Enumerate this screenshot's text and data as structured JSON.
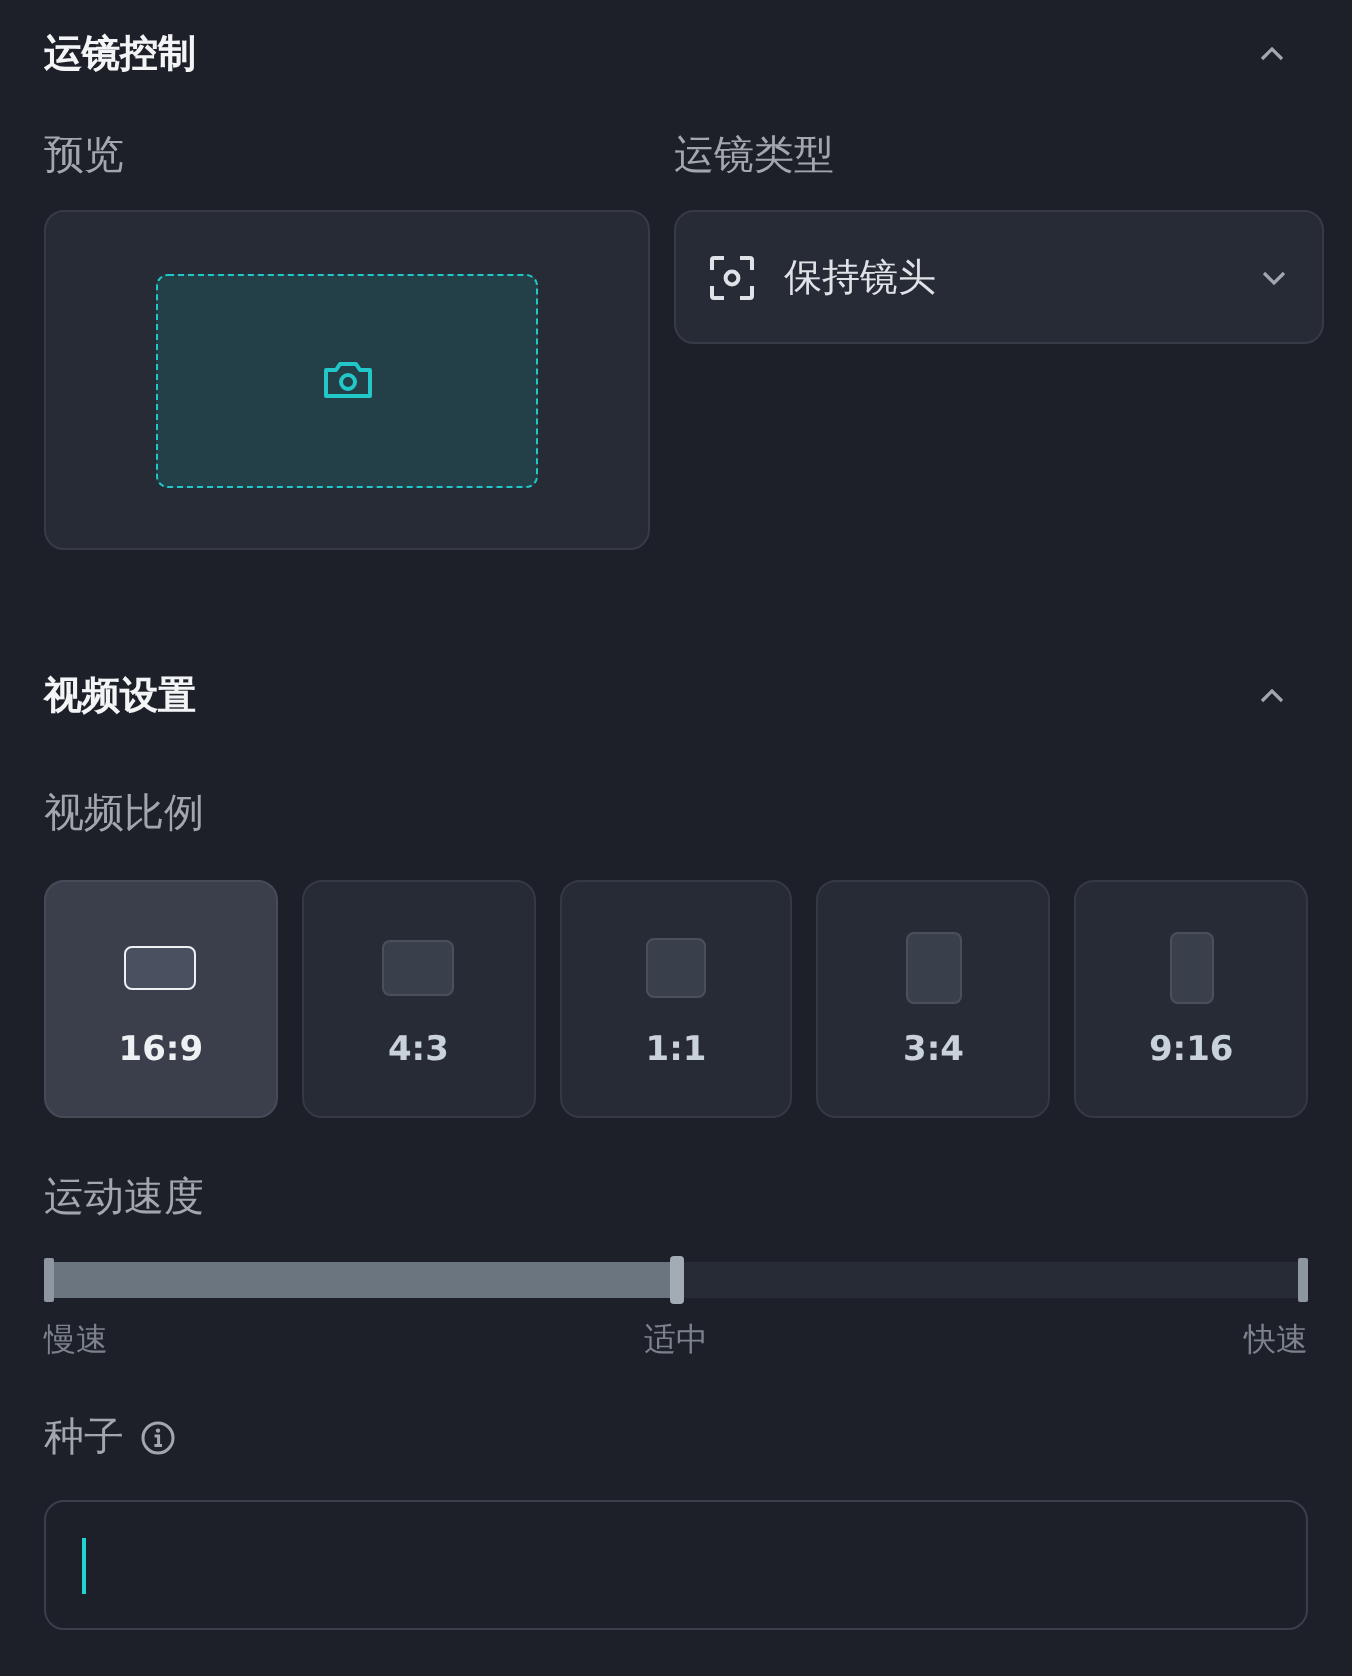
{
  "camera_section": {
    "title": "运镜控制",
    "expanded": true,
    "preview": {
      "label": "预览"
    },
    "motion_type": {
      "label": "运镜类型",
      "value": "保持镜头"
    }
  },
  "video_section": {
    "title": "视频设置",
    "expanded": true,
    "aspect_ratio": {
      "label": "视频比例",
      "options": [
        {
          "label": "16:9",
          "kind": "wide",
          "selected": true
        },
        {
          "label": "4:3",
          "kind": "standard",
          "selected": false
        },
        {
          "label": "1:1",
          "kind": "square",
          "selected": false
        },
        {
          "label": "3:4",
          "kind": "portrait",
          "selected": false
        },
        {
          "label": "9:16",
          "kind": "tall",
          "selected": false
        }
      ]
    },
    "motion_speed": {
      "label": "运动速度",
      "level": 0.5,
      "marks": [
        "慢速",
        "适中",
        "快速"
      ]
    },
    "seed": {
      "label": "种子",
      "focused": true
    }
  }
}
